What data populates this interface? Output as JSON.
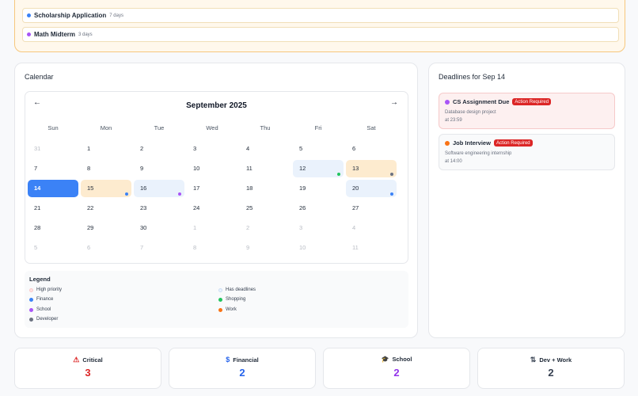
{
  "upcoming": {
    "items": [
      {
        "title": "Scholarship Application",
        "when": "7 days",
        "color": "#3b82f6"
      },
      {
        "title": "Math Midterm",
        "when": "3 days",
        "color": "#a855f7"
      }
    ]
  },
  "calendar": {
    "title": "Calendar",
    "month": "September 2025",
    "prev_icon": "arrow-left-icon",
    "next_icon": "arrow-right-icon",
    "prev_label": "←",
    "next_label": "→",
    "weekdays": [
      "Sun",
      "Mon",
      "Tue",
      "Wed",
      "Thu",
      "Fri",
      "Sat"
    ],
    "weeks": [
      [
        {
          "d": "31",
          "m": true
        },
        {
          "d": "1"
        },
        {
          "d": "2"
        },
        {
          "d": "3"
        },
        {
          "d": "4"
        },
        {
          "d": "5"
        },
        {
          "d": "6"
        }
      ],
      [
        {
          "d": "7"
        },
        {
          "d": "8"
        },
        {
          "d": "9"
        },
        {
          "d": "10"
        },
        {
          "d": "11"
        },
        {
          "d": "12",
          "s": "dl",
          "dot": "#22c55e"
        },
        {
          "d": "13",
          "s": "high",
          "dot": "#6b7280"
        }
      ],
      [
        {
          "d": "14",
          "s": "selected"
        },
        {
          "d": "15",
          "s": "high",
          "dot": "#3b82f6"
        },
        {
          "d": "16",
          "s": "dl",
          "dot": "#a855f7"
        },
        {
          "d": "17"
        },
        {
          "d": "18"
        },
        {
          "d": "19"
        },
        {
          "d": "20",
          "s": "dl",
          "dot": "#3b82f6"
        }
      ],
      [
        {
          "d": "21"
        },
        {
          "d": "22"
        },
        {
          "d": "23"
        },
        {
          "d": "24"
        },
        {
          "d": "25"
        },
        {
          "d": "26"
        },
        {
          "d": "27"
        }
      ],
      [
        {
          "d": "28"
        },
        {
          "d": "29"
        },
        {
          "d": "30"
        },
        {
          "d": "1",
          "m": true
        },
        {
          "d": "2",
          "m": true
        },
        {
          "d": "3",
          "m": true
        },
        {
          "d": "4",
          "m": true
        }
      ],
      [
        {
          "d": "5",
          "m": true
        },
        {
          "d": "6",
          "m": true
        },
        {
          "d": "7",
          "m": true
        },
        {
          "d": "8",
          "m": true
        },
        {
          "d": "9",
          "m": true
        },
        {
          "d": "10",
          "m": true
        },
        {
          "d": "11",
          "m": true
        }
      ]
    ]
  },
  "legend": {
    "title": "Legend",
    "items": [
      {
        "label": "High priority",
        "color": "#fde2e2",
        "outline": "#f9c9c9"
      },
      {
        "label": "Has deadlines",
        "color": "#eaf2fc",
        "outline": "#c9dcf3"
      },
      {
        "label": "Finance",
        "color": "#3b82f6"
      },
      {
        "label": "Shopping",
        "color": "#22c55e"
      },
      {
        "label": "School",
        "color": "#a855f7"
      },
      {
        "label": "Work",
        "color": "#f97316"
      },
      {
        "label": "Developer",
        "color": "#6b7280"
      }
    ]
  },
  "deadlines": {
    "title": "Deadlines for Sep 14",
    "items": [
      {
        "title": "CS Assignment Due",
        "badge": "Action Required",
        "desc": "Database design project",
        "time": "at 23:59",
        "color": "#a855f7",
        "bg": "#fdf0f0",
        "border": "#f6caca"
      },
      {
        "title": "Job Interview",
        "badge": "Action Required",
        "desc": "Software engineering internship",
        "time": "at 14:00",
        "color": "#f97316",
        "bg": "#f9fafb",
        "border": "#e5e7eb"
      }
    ]
  },
  "stats": [
    {
      "label": "Critical",
      "value": "3",
      "icon": "warning-triangle-icon",
      "glyph": "⚠",
      "color": "#dc2626"
    },
    {
      "label": "Financial",
      "value": "2",
      "icon": "dollar-icon",
      "glyph": "$",
      "color": "#2563eb"
    },
    {
      "label": "School",
      "value": "2",
      "icon": "graduation-cap-icon",
      "glyph": "🎓",
      "color": "#9333ea"
    },
    {
      "label": "Dev + Work",
      "value": "2",
      "icon": "git-compare-icon",
      "glyph": "⇅",
      "color": "#374151"
    }
  ]
}
